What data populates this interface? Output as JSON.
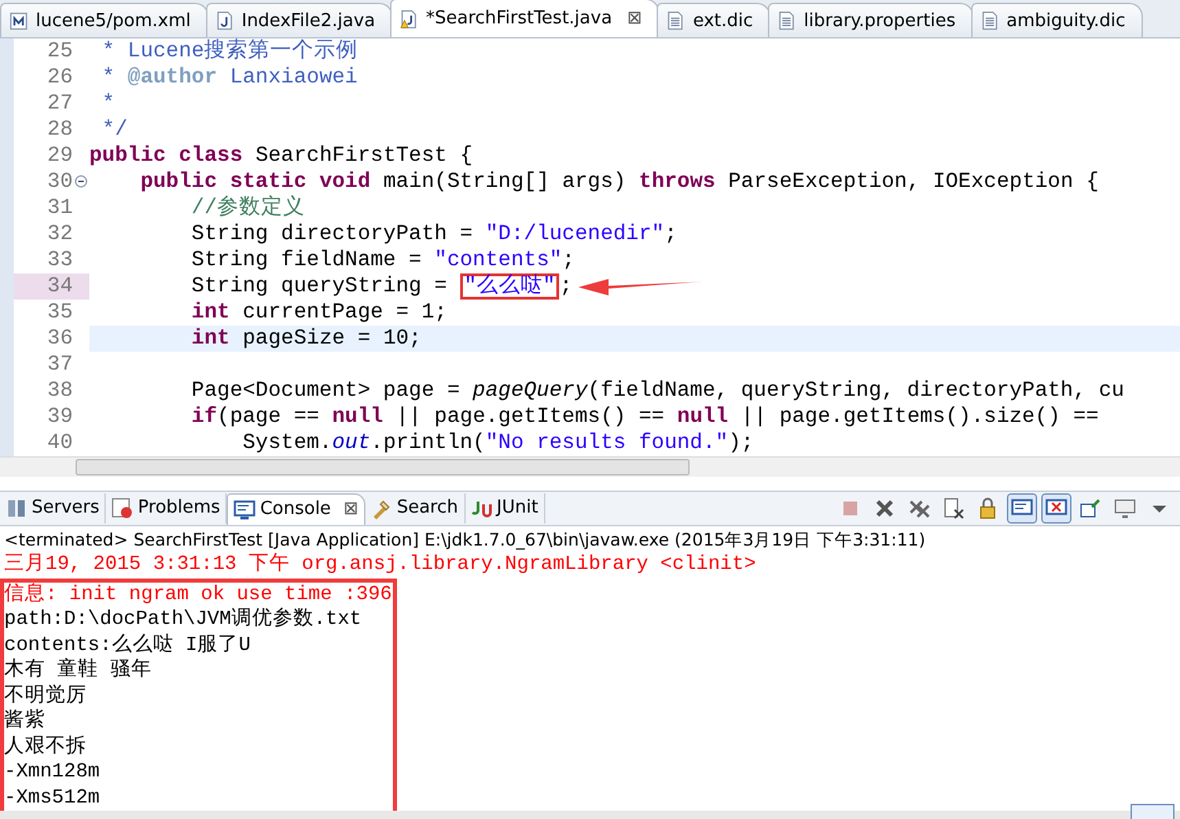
{
  "editor_tabs": [
    {
      "label": "lucene5/pom.xml",
      "kind": "xml",
      "selected": false
    },
    {
      "label": "IndexFile2.java",
      "kind": "java",
      "selected": false
    },
    {
      "label": "*SearchFirstTest.java",
      "kind": "java-warning",
      "selected": true,
      "close": "⊠"
    },
    {
      "label": "ext.dic",
      "kind": "text",
      "selected": false
    },
    {
      "label": "library.properties",
      "kind": "text",
      "selected": false
    },
    {
      "label": "ambiguity.dic",
      "kind": "text",
      "selected": false
    }
  ],
  "code_lines": [
    {
      "number": "25",
      "current": false,
      "marked": false,
      "foldable": false,
      "segments": [
        {
          "kind": "doc",
          "text": " * Lucene搜索第一个示例"
        }
      ]
    },
    {
      "number": "26",
      "current": false,
      "marked": false,
      "foldable": false,
      "segments": [
        {
          "kind": "doc",
          "text": " * "
        },
        {
          "kind": "doctag",
          "text": "@author"
        },
        {
          "kind": "doc",
          "text": " Lanxiaowei"
        }
      ]
    },
    {
      "number": "27",
      "current": false,
      "marked": false,
      "foldable": false,
      "segments": [
        {
          "kind": "doc",
          "text": " *"
        }
      ]
    },
    {
      "number": "28",
      "current": false,
      "marked": false,
      "foldable": false,
      "segments": [
        {
          "kind": "doc",
          "text": " */"
        }
      ]
    },
    {
      "number": "29",
      "current": false,
      "marked": false,
      "foldable": false,
      "segments": [
        {
          "kind": "kw",
          "text": "public "
        },
        {
          "kind": "kw",
          "text": "class"
        },
        {
          "kind": "plain",
          "text": " SearchFirstTest {"
        }
      ]
    },
    {
      "number": "30",
      "current": false,
      "marked": false,
      "foldable": true,
      "segments": [
        {
          "kind": "kw",
          "text": "    public "
        },
        {
          "kind": "kw",
          "text": "static "
        },
        {
          "kind": "kw",
          "text": "void"
        },
        {
          "kind": "plain",
          "text": " main(String[] args) "
        },
        {
          "kind": "kw",
          "text": "throws"
        },
        {
          "kind": "plain",
          "text": " ParseException, IOException {"
        }
      ]
    },
    {
      "number": "31",
      "current": false,
      "marked": false,
      "foldable": false,
      "segments": [
        {
          "kind": "comment",
          "text": "        //参数定义"
        }
      ]
    },
    {
      "number": "32",
      "current": false,
      "marked": false,
      "foldable": false,
      "segments": [
        {
          "kind": "plain",
          "text": "        String directoryPath = "
        },
        {
          "kind": "str",
          "text": "\"D:/lucenedir\""
        },
        {
          "kind": "plain",
          "text": ";"
        }
      ]
    },
    {
      "number": "33",
      "current": false,
      "marked": false,
      "foldable": false,
      "segments": [
        {
          "kind": "plain",
          "text": "        String fieldName = "
        },
        {
          "kind": "str",
          "text": "\"contents\""
        },
        {
          "kind": "plain",
          "text": ";"
        }
      ]
    },
    {
      "number": "34",
      "current": false,
      "marked": true,
      "foldable": false,
      "segments": [
        {
          "kind": "plain",
          "text": "        String queryString = "
        },
        {
          "kind": "boxed-str",
          "text": "\"么么哒\""
        },
        {
          "kind": "plain",
          "text": ";"
        }
      ]
    },
    {
      "number": "35",
      "current": false,
      "marked": false,
      "foldable": false,
      "segments": [
        {
          "kind": "kw",
          "text": "        int"
        },
        {
          "kind": "plain",
          "text": " currentPage = 1;"
        }
      ]
    },
    {
      "number": "36",
      "current": true,
      "marked": false,
      "foldable": false,
      "segments": [
        {
          "kind": "kw",
          "text": "        int"
        },
        {
          "kind": "plain",
          "text": " pageSize = 10;"
        }
      ]
    },
    {
      "number": "37",
      "current": false,
      "marked": false,
      "foldable": false
    },
    {
      "number": "38",
      "current": false,
      "marked": false,
      "foldable": false,
      "segments": [
        {
          "kind": "plain",
          "text": "        Page<Document> page = "
        },
        {
          "kind": "italic",
          "text": "pageQuery"
        },
        {
          "kind": "plain",
          "text": "(fieldName, queryString, directoryPath, cu"
        }
      ]
    },
    {
      "number": "39",
      "current": false,
      "marked": false,
      "foldable": false,
      "segments": [
        {
          "kind": "kw",
          "text": "        if"
        },
        {
          "kind": "plain",
          "text": "(page == "
        },
        {
          "kind": "kw",
          "text": "null"
        },
        {
          "kind": "plain",
          "text": " || page.getItems() == "
        },
        {
          "kind": "kw",
          "text": "null"
        },
        {
          "kind": "plain",
          "text": " || page.getItems().size() =="
        }
      ]
    },
    {
      "number": "40",
      "current": false,
      "marked": false,
      "foldable": false,
      "segments": [
        {
          "kind": "plain",
          "text": "            System."
        },
        {
          "kind": "field",
          "text": "out"
        },
        {
          "kind": "plain",
          "text": ".println("
        },
        {
          "kind": "str",
          "text": "\"No results found.\""
        },
        {
          "kind": "plain",
          "text": ");"
        }
      ]
    }
  ],
  "panel_tabs": [
    {
      "label": "Servers",
      "kind": "servers",
      "selected": false
    },
    {
      "label": "Problems",
      "kind": "problems",
      "selected": false
    },
    {
      "label": "Console",
      "kind": "console",
      "selected": true,
      "close": "⊠"
    },
    {
      "label": "Search",
      "kind": "search",
      "selected": false
    },
    {
      "label": "JUnit",
      "kind": "junit",
      "selected": false
    }
  ],
  "console_toolbar": [
    {
      "kind": "stop",
      "disabled": true
    },
    {
      "kind": "remove",
      "disabled": false
    },
    {
      "kind": "remove-all",
      "disabled": false
    },
    {
      "kind": "clear",
      "disabled": false
    },
    {
      "kind": "lock",
      "disabled": false
    },
    {
      "kind": "show-out",
      "disabled": false,
      "pressed": true
    },
    {
      "kind": "show-err",
      "disabled": false,
      "pressed": true
    },
    {
      "kind": "pin",
      "disabled": false
    },
    {
      "kind": "monitor",
      "disabled": false
    },
    {
      "kind": "caret",
      "disabled": false
    }
  ],
  "console_header": "<terminated> SearchFirstTest [Java Application] E:\\jdk1.7.0_67\\bin\\javaw.exe (2015年3月19日 下午3:31:11)",
  "console_lines": [
    {
      "kind": "stderr",
      "boxed": false,
      "text": "三月19, 2015 3:31:13 下午 org.ansj.library.NgramLibrary <clinit>"
    },
    {
      "kind": "stderr",
      "boxed": true,
      "text": "信息: init ngram ok use time :396"
    },
    {
      "kind": "stdout",
      "boxed": true,
      "text": "path:D:\\docPath\\JVM调优参数.txt"
    },
    {
      "kind": "stdout",
      "boxed": true,
      "text": "contents:么么哒 I服了U"
    },
    {
      "kind": "stdout",
      "boxed": true,
      "text": "木有 童鞋 骚年"
    },
    {
      "kind": "stdout",
      "boxed": true,
      "text": "不明觉厉"
    },
    {
      "kind": "stdout",
      "boxed": true,
      "text": "酱紫"
    },
    {
      "kind": "stdout",
      "boxed": true,
      "text": "人艰不拆"
    },
    {
      "kind": "stdout",
      "boxed": true,
      "text": "-Xmn128m"
    },
    {
      "kind": "stdout",
      "boxed": true,
      "text": "-Xms512m"
    }
  ]
}
